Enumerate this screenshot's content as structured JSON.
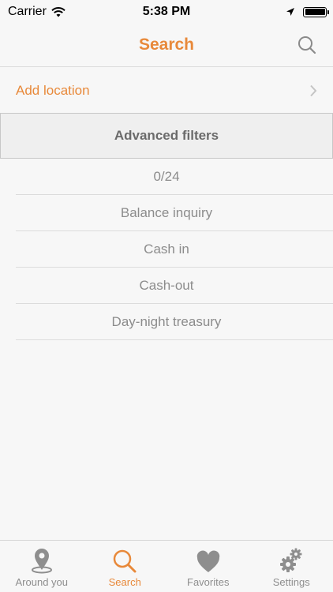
{
  "status_bar": {
    "carrier": "Carrier",
    "time": "5:38 PM"
  },
  "nav": {
    "title": "Search"
  },
  "add_location": {
    "label": "Add location"
  },
  "advanced_filters": {
    "label": "Advanced filters"
  },
  "filters": {
    "count": "0/24",
    "items": [
      "Balance inquiry",
      "Cash in",
      "Cash-out",
      "Day-night treasury"
    ]
  },
  "tabs": [
    {
      "label": "Around you",
      "icon": "location-pin-icon",
      "active": false
    },
    {
      "label": "Search",
      "icon": "search-icon",
      "active": true
    },
    {
      "label": "Favorites",
      "icon": "heart-icon",
      "active": false
    },
    {
      "label": "Settings",
      "icon": "gear-icon",
      "active": false
    }
  ],
  "colors": {
    "accent": "#e8893a",
    "text_muted": "#8c8c8c",
    "background": "#f7f7f7"
  }
}
